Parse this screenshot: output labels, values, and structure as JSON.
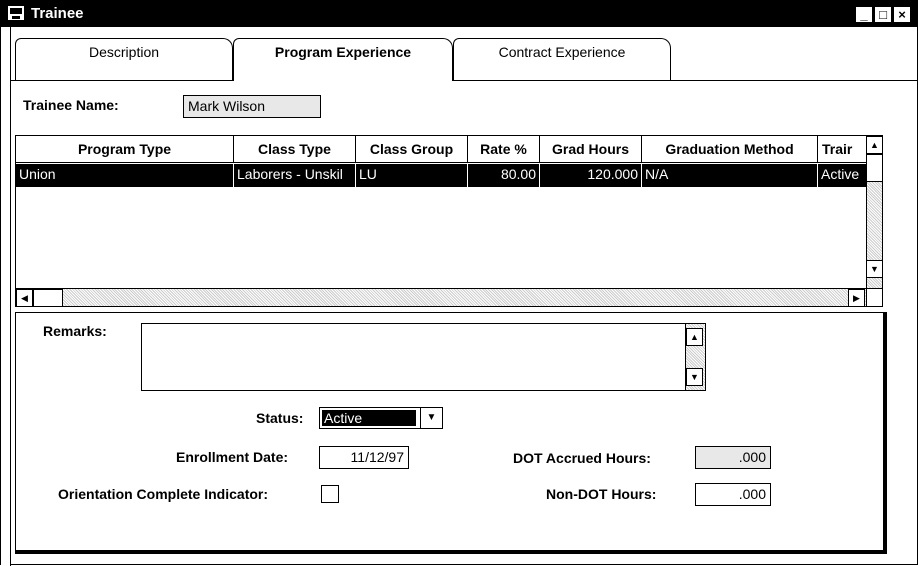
{
  "window": {
    "title": "Trainee",
    "minimize_glyph": "_",
    "maximize_glyph": "□",
    "close_glyph": "×"
  },
  "tabs": [
    {
      "label": "Description",
      "active": false
    },
    {
      "label": "Program Experience",
      "active": true
    },
    {
      "label": "Contract Experience",
      "active": false
    }
  ],
  "trainee": {
    "label": "Trainee Name:",
    "value": "Mark Wilson"
  },
  "grid": {
    "columns": [
      "Program Type",
      "Class Type",
      "Class Group",
      "Rate %",
      "Grad Hours",
      "Graduation Method",
      "Trair"
    ],
    "rows": [
      [
        "Union",
        "Laborers - Unskil",
        "LU",
        "80.00",
        "120.000",
        "N/A",
        "Active"
      ]
    ],
    "selected_row": 0
  },
  "form": {
    "remarks_label": "Remarks:",
    "remarks_value": "",
    "status_label": "Status:",
    "status_value": "Active",
    "enrollment_label": "Enrollment Date:",
    "enrollment_value": "11/12/97",
    "orientation_label": "Orientation Complete Indicator:",
    "orientation_checked": false,
    "dot_label": "DOT Accrued Hours:",
    "dot_value": ".000",
    "nondot_label": "Non-DOT Hours:",
    "nondot_value": ".000"
  },
  "icons": {
    "app": "app-icon",
    "up": "▲",
    "down": "▼",
    "left": "◀",
    "right": "▶",
    "dropdown": "▼"
  }
}
